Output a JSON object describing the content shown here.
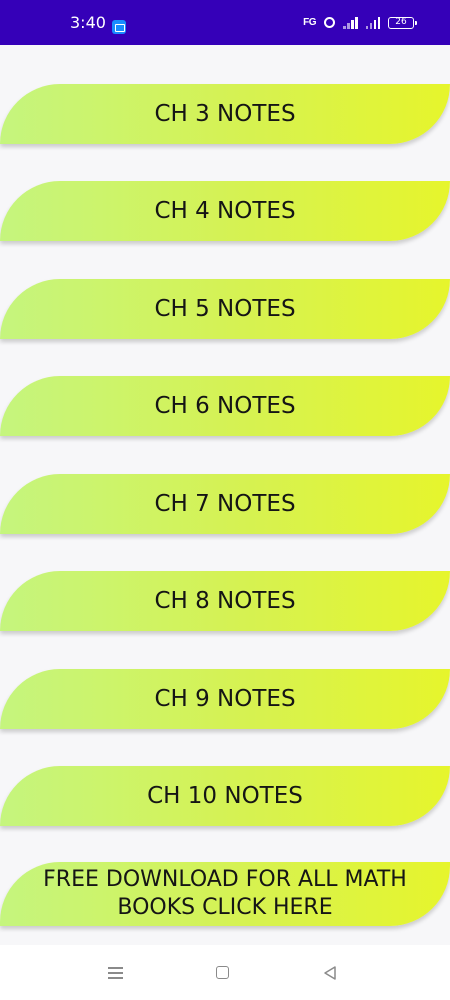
{
  "status_bar": {
    "time": "3:40",
    "app_icon": "gallery-icon",
    "fg_label": "FG",
    "alarm_icon": "alarm-icon",
    "signal_icon": "signal-icon",
    "battery": "26"
  },
  "buttons": [
    {
      "label": "CH 3 NOTES"
    },
    {
      "label": "CH 4 NOTES"
    },
    {
      "label": "CH 5 NOTES"
    },
    {
      "label": "CH 6 NOTES"
    },
    {
      "label": "CH 7 NOTES"
    },
    {
      "label": "CH 8 NOTES"
    },
    {
      "label": "CH 9 NOTES"
    },
    {
      "label": "CH 10 NOTES"
    },
    {
      "label": "FREE DOWNLOAD FOR ALL MATH BOOKS CLICK HERE"
    }
  ],
  "colors": {
    "status_bar": "#3500b8",
    "button_start": "#c5f57e",
    "button_end": "#e6f52c",
    "background": "#f7f7f9"
  },
  "nav_bar": {
    "menu_icon": "menu-icon",
    "home_icon": "home-square-icon",
    "back_icon": "back-triangle-icon"
  }
}
